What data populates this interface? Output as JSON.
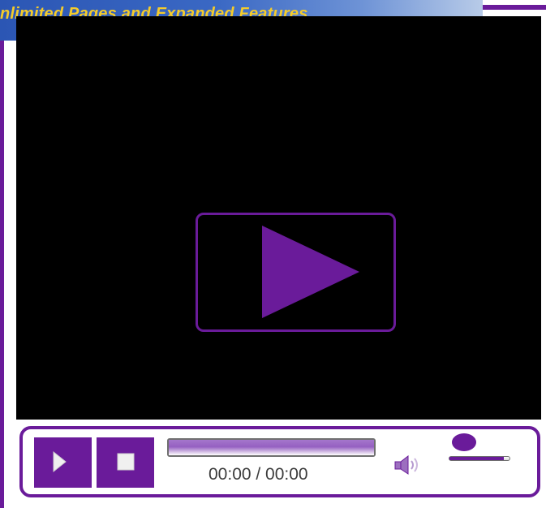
{
  "promo": {
    "text": "nlimited Pages and Expanded Features"
  },
  "player": {
    "time_display": "00:00 / 00:00",
    "progress": 0,
    "volume": 0.9,
    "icons": {
      "big_play": "play-icon",
      "play": "play-icon",
      "stop": "stop-icon",
      "volume": "speaker-icon"
    },
    "colors": {
      "accent": "#6a1b9a",
      "video_bg": "#000000",
      "time_text": "#3c3c3c",
      "promo_text": "#f5cc2a",
      "promo_bg": "#3a68c4"
    }
  }
}
